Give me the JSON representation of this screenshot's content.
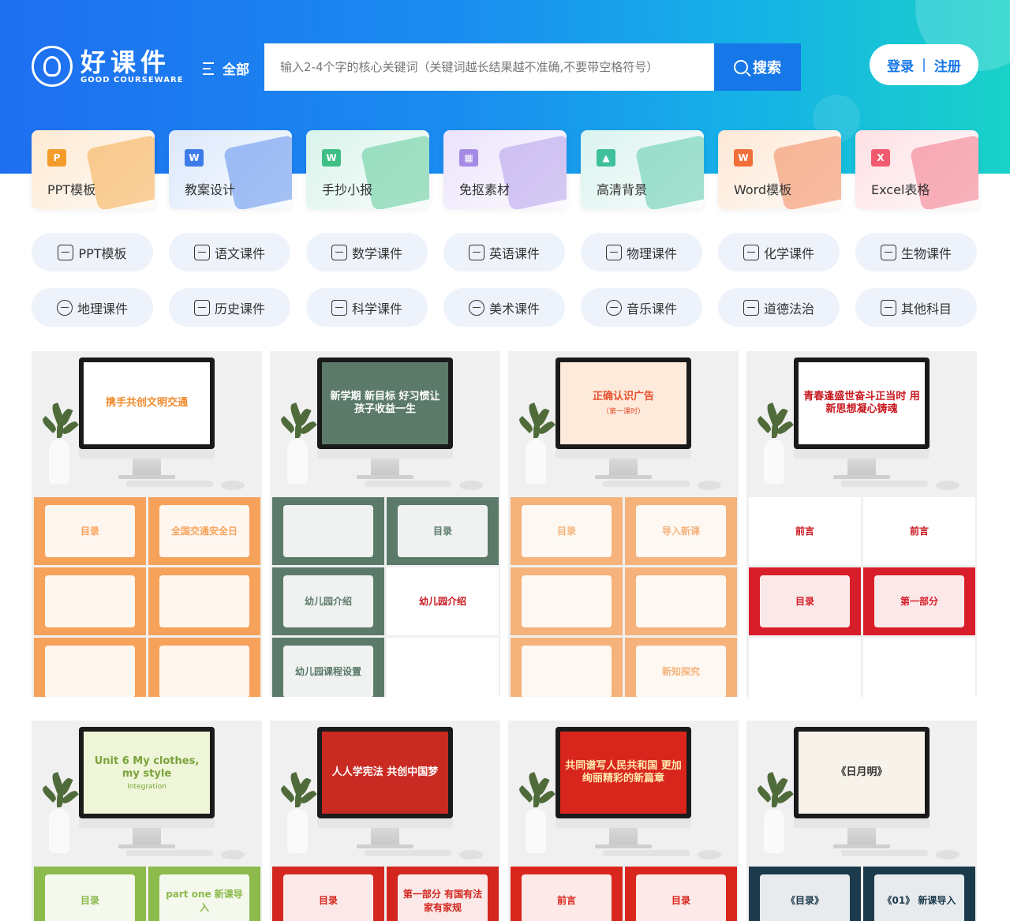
{
  "header": {
    "logo_cn": "好课件",
    "logo_en": "GOOD COURSEWARE",
    "all_label": "全部",
    "search_placeholder": "输入2-4个字的核心关键词（关键词越长结果越不准确,不要带空格符号）",
    "search_value": "",
    "search_button": "搜索",
    "login_label": "登录",
    "separator": "|",
    "register_label": "注册"
  },
  "categories": [
    {
      "label": "PPT模板",
      "icon": "P",
      "icon_color": "#f39c2b",
      "bg": "#fde9d2"
    },
    {
      "label": "教案设计",
      "icon": "W",
      "icon_color": "#3d7be8",
      "bg": "#dbe8fb"
    },
    {
      "label": "手抄小报",
      "icon": "W",
      "icon_color": "#3fbf85",
      "bg": "#d9f3ea"
    },
    {
      "label": "免抠素材",
      "icon": "▦",
      "icon_color": "#a58be6",
      "bg": "#ebe3fb"
    },
    {
      "label": "高清背景",
      "icon": "▲",
      "icon_color": "#3fbf9c",
      "bg": "#daf3ee"
    },
    {
      "label": "Word模板",
      "icon": "W",
      "icon_color": "#f06f3a",
      "bg": "#fde8d6"
    },
    {
      "label": "Excel表格",
      "icon": "X",
      "icon_color": "#ef5a6e",
      "bg": "#fde0e4"
    }
  ],
  "subjects": [
    {
      "label": "PPT模板",
      "icon": "ppt-file-icon"
    },
    {
      "label": "语文课件",
      "icon": "book-icon"
    },
    {
      "label": "数学课件",
      "icon": "calculator-icon"
    },
    {
      "label": "英语课件",
      "icon": "english-icon"
    },
    {
      "label": "物理课件",
      "icon": "physics-icon"
    },
    {
      "label": "化学课件",
      "icon": "flask-icon"
    },
    {
      "label": "生物课件",
      "icon": "microscope-icon"
    },
    {
      "label": "地理课件",
      "icon": "globe-icon"
    },
    {
      "label": "历史课件",
      "icon": "history-icon"
    },
    {
      "label": "科学课件",
      "icon": "beaker-icon"
    },
    {
      "label": "美术课件",
      "icon": "palette-icon"
    },
    {
      "label": "音乐课件",
      "icon": "music-icon"
    },
    {
      "label": "道德法治",
      "icon": "scale-icon"
    },
    {
      "label": "其他科目",
      "icon": "more-icon"
    }
  ],
  "resources": [
    {
      "title": "携手共创文明交通",
      "subtitle": "",
      "bg": "#ffffff",
      "color": "#f08a2c",
      "slides": [
        {
          "text": "目录",
          "bg": "#f7a25a"
        },
        {
          "text": "全国交通安全日",
          "bg": "#f7a25a"
        },
        {
          "text": "",
          "bg": "#f7a25a"
        },
        {
          "text": "",
          "bg": "#f7a25a"
        },
        {
          "text": "",
          "bg": "#f7a25a"
        },
        {
          "text": "",
          "bg": "#f7a25a"
        }
      ]
    },
    {
      "title": "新学期 新目标 好习惯让孩子收益一生",
      "subtitle": "",
      "bg": "#5b7a6a",
      "color": "#ffffff",
      "slides": [
        {
          "text": "",
          "bg": "#5b7a6a"
        },
        {
          "text": "目录",
          "bg": "#5b7a6a"
        },
        {
          "text": "幼儿园介绍",
          "bg": "#5b7a6a"
        },
        {
          "text": "幼儿园介绍",
          "bg": "#ffffff"
        },
        {
          "text": "幼儿园课程设置",
          "bg": "#5b7a6a"
        },
        {
          "text": "",
          "bg": "#ffffff"
        }
      ]
    },
    {
      "title": "正确认识广告",
      "subtitle": "（第一课时）",
      "bg": "#fdeadb",
      "color": "#e8502e",
      "slides": [
        {
          "text": "目录",
          "bg": "#f5b27a"
        },
        {
          "text": "导入新课",
          "bg": "#f5b27a"
        },
        {
          "text": "",
          "bg": "#f5b27a"
        },
        {
          "text": "",
          "bg": "#f5b27a"
        },
        {
          "text": "",
          "bg": "#f5b27a"
        },
        {
          "text": "新知探究",
          "bg": "#f5b27a"
        }
      ]
    },
    {
      "title": "青春逢盛世奋斗正当时 用新思想凝心铸魂",
      "subtitle": "",
      "bg": "#ffffff",
      "color": "#c8161d",
      "slides": [
        {
          "text": "前言",
          "bg": "#ffffff"
        },
        {
          "text": "前言",
          "bg": "#ffffff"
        },
        {
          "text": "目录",
          "bg": "#d81e2a"
        },
        {
          "text": "第一部分",
          "bg": "#d81e2a"
        },
        {
          "text": "",
          "bg": "#ffffff"
        },
        {
          "text": "",
          "bg": "#ffffff"
        }
      ]
    },
    {
      "title": "Unit 6 My clothes, my style",
      "subtitle": "Integration",
      "bg": "#eef5d8",
      "color": "#7aa33b",
      "slides": [
        {
          "text": "目录",
          "bg": "#8cba4b"
        },
        {
          "text": "part one 新课导入",
          "bg": "#8cba4b"
        }
      ]
    },
    {
      "title": "人人学宪法 共创中国梦",
      "subtitle": "",
      "bg": "#c92a22",
      "color": "#ffffff",
      "slides": [
        {
          "text": "目录",
          "bg": "#d3261f"
        },
        {
          "text": "第一部分 有国有法 家有家规",
          "bg": "#d3261f"
        }
      ]
    },
    {
      "title": "共同谱写人民共和国 更加绚丽精彩的新篇章",
      "subtitle": "",
      "bg": "#d9261c",
      "color": "#ffe9b0",
      "slides": [
        {
          "text": "前言",
          "bg": "#d9261c"
        },
        {
          "text": "目录",
          "bg": "#d9261c"
        }
      ]
    },
    {
      "title": "《日月明》",
      "subtitle": "",
      "bg": "#f7f3ea",
      "color": "#333333",
      "slides": [
        {
          "text": "《目录》",
          "bg": "#1b3a4b"
        },
        {
          "text": "《01》 新课导入",
          "bg": "#1b3a4b"
        }
      ]
    }
  ]
}
